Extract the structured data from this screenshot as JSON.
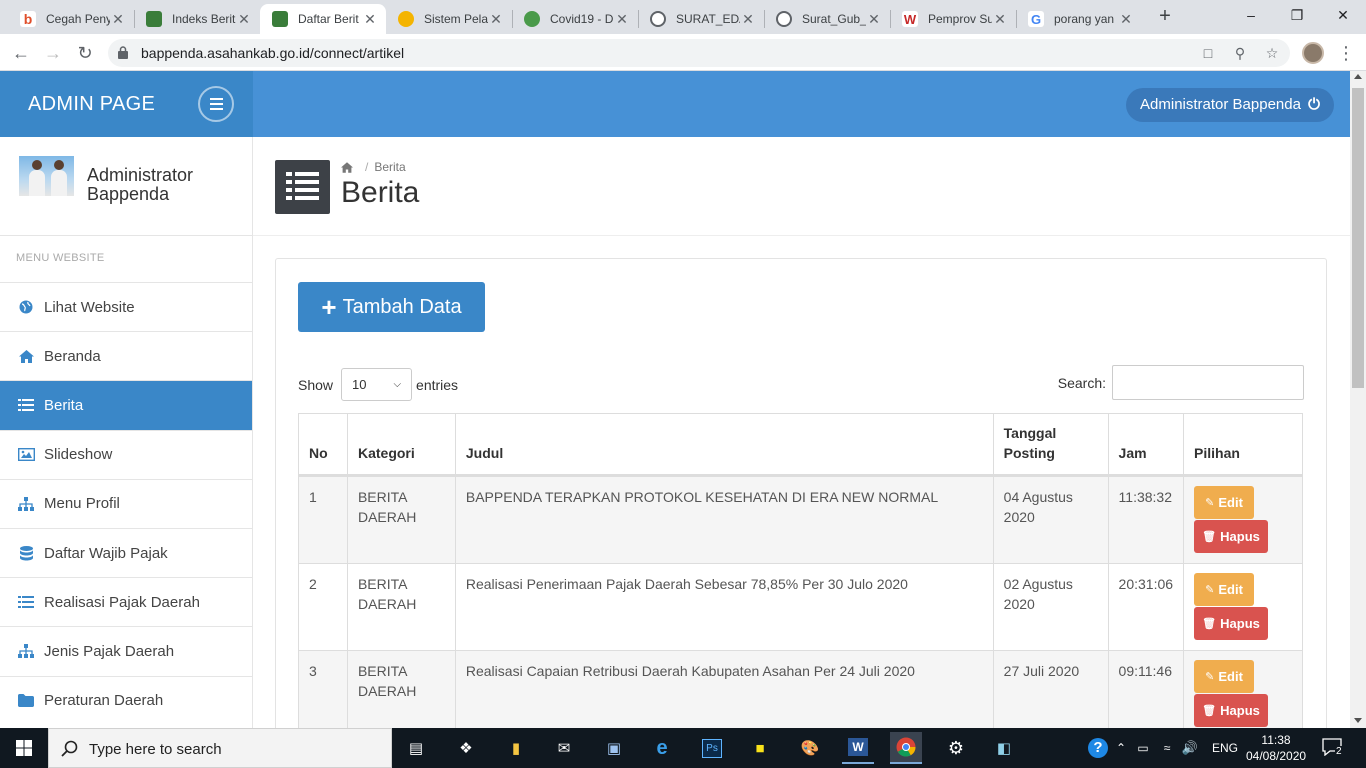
{
  "browser": {
    "tabs": [
      {
        "title": "Cegah Penye",
        "favicon": "b",
        "color": "#e04f2b"
      },
      {
        "title": "Indeks Berit",
        "favicon": "logo",
        "color": "#2e7d32"
      },
      {
        "title": "Daftar Berit",
        "favicon": "logo",
        "color": "#2e7d32",
        "active": true
      },
      {
        "title": "Sistem Pelay",
        "favicon": "s",
        "color": "#f4b400"
      },
      {
        "title": "Covid19 - D",
        "favicon": "c",
        "color": "#2e7d32"
      },
      {
        "title": "SURAT_EDA",
        "favicon": "globe",
        "color": "#5f6368"
      },
      {
        "title": "Surat_Gub_",
        "favicon": "globe",
        "color": "#5f6368"
      },
      {
        "title": "Pemprov Su",
        "favicon": "W",
        "color": "#c62828"
      },
      {
        "title": "porang yan",
        "favicon": "G",
        "color": "#4285f4"
      }
    ],
    "url": "bappenda.asahankab.go.id/connect/artikel"
  },
  "header": {
    "brand": "ADMIN PAGE",
    "user_button": "Administrator Bappenda"
  },
  "sidebar": {
    "profile_name": "Administrator Bappenda",
    "menu_heading": "MENU WEBSITE",
    "items": [
      {
        "label": "Lihat Website",
        "icon": "globe-icon"
      },
      {
        "label": "Beranda",
        "icon": "home-icon"
      },
      {
        "label": "Berita",
        "icon": "list-icon",
        "active": true
      },
      {
        "label": "Slideshow",
        "icon": "image-icon"
      },
      {
        "label": "Menu Profil",
        "icon": "sitemap-icon"
      },
      {
        "label": "Daftar Wajib Pajak",
        "icon": "database-icon"
      },
      {
        "label": "Realisasi Pajak Daerah",
        "icon": "list-icon"
      },
      {
        "label": "Jenis Pajak Daerah",
        "icon": "sitemap-icon"
      },
      {
        "label": "Peraturan Daerah",
        "icon": "folder-icon"
      }
    ]
  },
  "page": {
    "breadcrumb": "Berita",
    "title": "Berita",
    "add_button": "Tambah Data",
    "show_label": "Show",
    "entries_value": "10",
    "entries_label": "entries",
    "search_label": "Search:",
    "columns": [
      "No",
      "Kategori",
      "Judul",
      "Tanggal Posting",
      "Jam",
      "Pilihan"
    ],
    "rows": [
      {
        "no": "1",
        "kategori": "BERITA DAERAH",
        "judul": "BAPPENDA TERAPKAN PROTOKOL KESEHATAN DI ERA NEW NORMAL",
        "tanggal": "04 Agustus 2020",
        "jam": "11:38:32"
      },
      {
        "no": "2",
        "kategori": "BERITA DAERAH",
        "judul": "Realisasi Penerimaan Pajak Daerah Sebesar 78,85% Per 30 Julo 2020",
        "tanggal": "02 Agustus 2020",
        "jam": "20:31:06"
      },
      {
        "no": "3",
        "kategori": "BERITA DAERAH",
        "judul": "Realisasi Capaian Retribusi Daerah Kabupaten Asahan Per 24 Juli 2020",
        "tanggal": "27 Juli 2020",
        "jam": "09:11:46"
      }
    ],
    "edit_label": "Edit",
    "delete_label": "Hapus"
  },
  "taskbar": {
    "search_placeholder": "Type here to search",
    "language": "ENG",
    "time": "11:38",
    "date": "04/08/2020",
    "notifications": "2"
  }
}
